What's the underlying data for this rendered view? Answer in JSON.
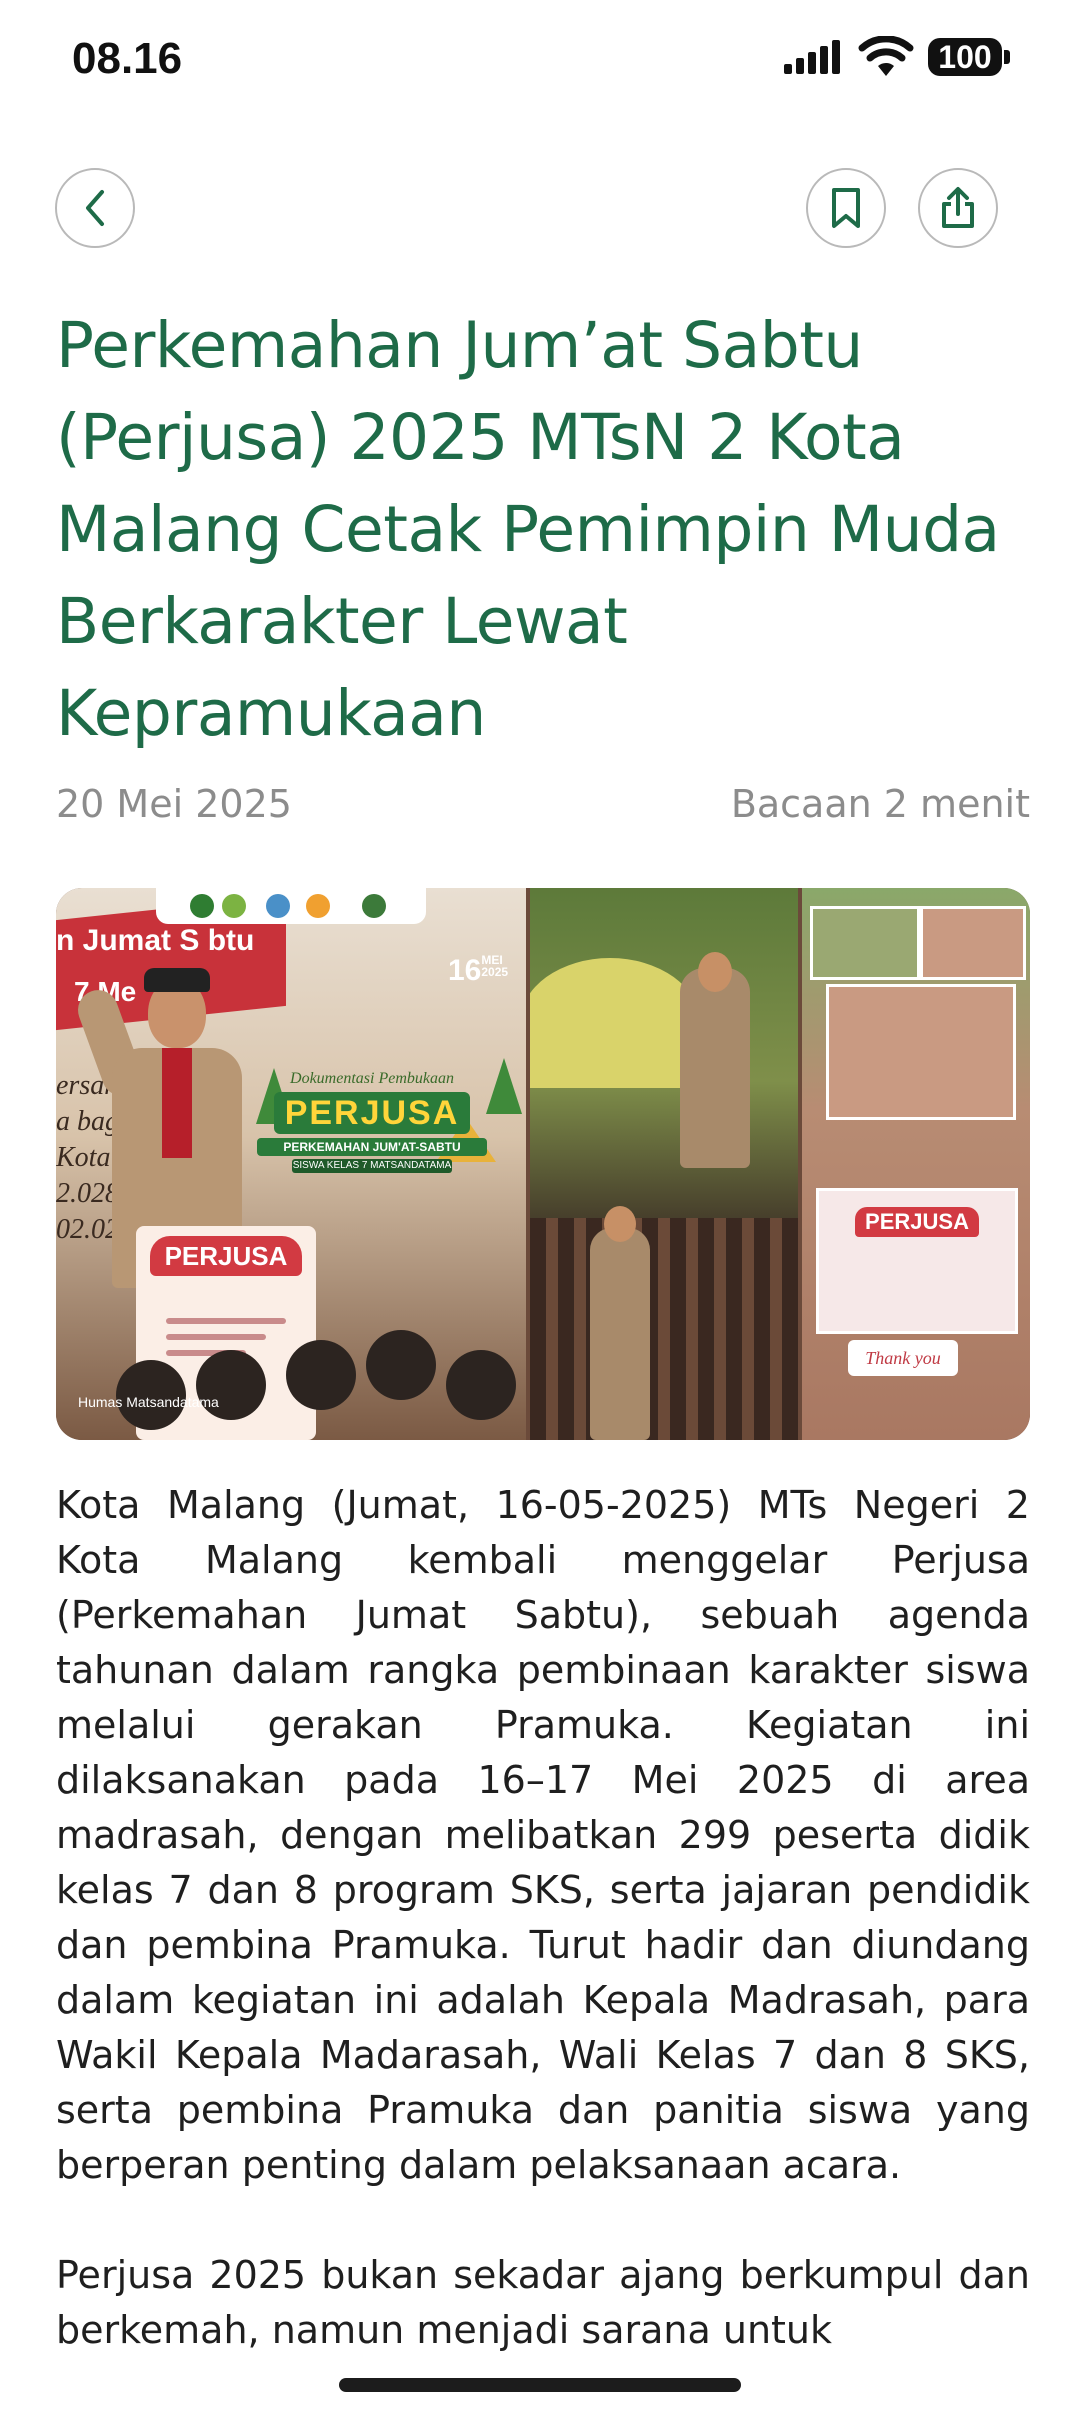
{
  "status_bar": {
    "time": "08.16",
    "battery": "100"
  },
  "toolbar": {
    "back_icon": "chevron-left-icon",
    "bookmark_icon": "bookmark-icon",
    "share_icon": "share-icon"
  },
  "article": {
    "title": "Perkemahan Jum’at Sabtu (Perjusa) 2025 MTsN 2 Kota Malang Cetak Pemimpin Muda Berkarakter Lewat Kepramukaan",
    "date": "20 Mei 2025",
    "read_time": "Bacaan 2 menit",
    "paragraphs": [
      "Kota Malang (Jumat, 16-05-2025) MTs Negeri 2 Kota Malang kembali menggelar Perjusa (Perkemahan Jumat Sabtu), sebuah agenda tahunan dalam rangka pembinaan karakter siswa melalui gerakan Pramuka. Kegiatan ini dilaksanakan pada 16–17 Mei 2025 di area madrasah, dengan melibatkan 299 peserta didik kelas 7 dan 8 program SKS, serta jajaran pendidik dan pembina Pramuka. Turut hadir dan diundang dalam kegiatan ini adalah Kepala Madrasah, para Wakil Kepala Madarasah, Wali Kelas 7 dan 8 SKS, serta pembina Pramuka dan panitia siswa yang berperan penting dalam pelaksanaan acara.",
      "Perjusa 2025 bukan sekadar ajang berkumpul dan berkemah, namun menjadi sarana untuk"
    ]
  },
  "photo": {
    "banner_line1": "n Jumat S  btu",
    "banner_line2": "7 Me",
    "side_text": "ersama a bagi Kota Ma 2.028 - 02.02",
    "date_day": "16",
    "date_month": "MEI",
    "date_year": "2025",
    "event_script": "Dokumentasi Pembukaan",
    "event_name": "PERJUSA",
    "event_subtitle": "PERKEMAHAN JUM'AT-SABTU",
    "event_class": "SISWA KELAS 7 MATSANDATAMA",
    "poster_title": "PERJUSA",
    "credit": "Humas Matsandatama",
    "poster2_title": "PERJUSA",
    "thanks": "Thank you"
  },
  "colors": {
    "title_green": "#1e6b48",
    "meta_gray": "#8c8c8c",
    "text": "#1f1f1f"
  }
}
